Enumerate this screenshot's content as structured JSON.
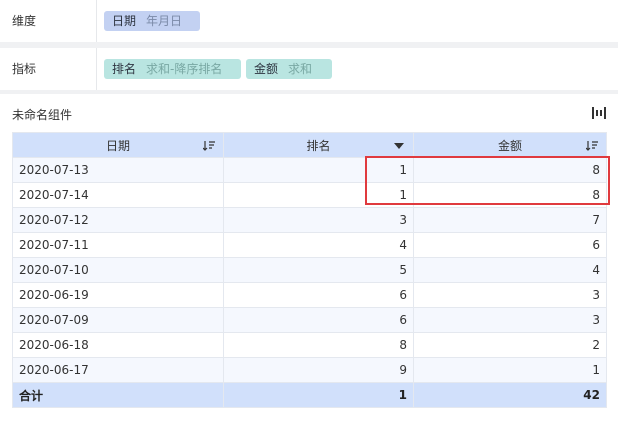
{
  "dimension_bar": {
    "label": "维度",
    "fields": [
      {
        "name": "日期",
        "aggregation": "年月日"
      }
    ]
  },
  "metric_bar": {
    "label": "指标",
    "fields": [
      {
        "name": "排名",
        "aggregation": "求和-降序排名"
      },
      {
        "name": "金额",
        "aggregation": "求和"
      }
    ]
  },
  "widget": {
    "title": "未命名组件",
    "tool_icon": "chart-settings-icon",
    "columns": [
      {
        "label": "日期",
        "icon": "sort-icon"
      },
      {
        "label": "排名",
        "icon": "dropdown-icon"
      },
      {
        "label": "金额",
        "icon": "sort-icon"
      }
    ],
    "rows": [
      {
        "date": "2020-07-13",
        "rank": "1",
        "amount": "8"
      },
      {
        "date": "2020-07-14",
        "rank": "1",
        "amount": "8"
      },
      {
        "date": "2020-07-12",
        "rank": "3",
        "amount": "7"
      },
      {
        "date": "2020-07-11",
        "rank": "4",
        "amount": "6"
      },
      {
        "date": "2020-07-10",
        "rank": "5",
        "amount": "4"
      },
      {
        "date": "2020-06-19",
        "rank": "6",
        "amount": "3"
      },
      {
        "date": "2020-07-09",
        "rank": "6",
        "amount": "3"
      },
      {
        "date": "2020-06-18",
        "rank": "8",
        "amount": "2"
      },
      {
        "date": "2020-06-17",
        "rank": "9",
        "amount": "1"
      }
    ],
    "total": {
      "label": "合计",
      "rank": "1",
      "amount": "42"
    },
    "highlight_color": "#e03a3e"
  }
}
